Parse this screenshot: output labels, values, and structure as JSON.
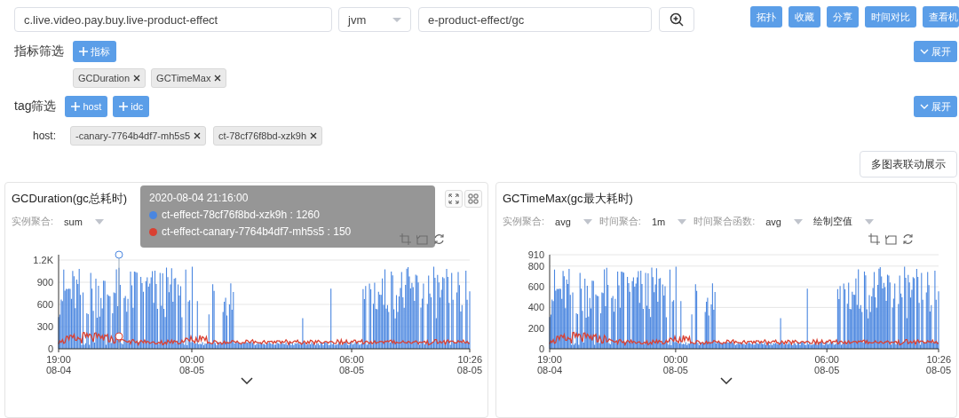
{
  "query": {
    "service": "c.live.video.pay.buy.live-product-effect",
    "type": "jvm",
    "path": "e-product-effect/gc"
  },
  "actions": [
    "拓扑",
    "收藏",
    "分享",
    "时间对比",
    "查看机"
  ],
  "metric_filter": {
    "label": "指标筛选",
    "add_button": "指标",
    "expand": "展开",
    "tags": [
      "GCDuration",
      "GCTimeMax"
    ]
  },
  "tag_filter": {
    "label": "tag筛选",
    "add_buttons": [
      "host",
      "idc"
    ],
    "expand": "展开",
    "host_label": "host:",
    "hosts": [
      "-canary-7764b4df7-mh5s5",
      "ct-78cf76f8bd-xzk9h"
    ]
  },
  "link_button": "多图表联动展示",
  "charts": [
    {
      "title": "GCDuration(gc总耗时)",
      "controls": [
        {
          "label": "实例聚合:",
          "value": "sum"
        }
      ],
      "y_ticks": [
        "1.2K",
        "900",
        "600",
        "300",
        "0"
      ],
      "x_ticks": [
        {
          "time": "19:00",
          "date": "08-04"
        },
        {
          "time": "00:00",
          "date": "08-05"
        },
        {
          "time": "06:00",
          "date": "08-05"
        },
        {
          "time": "10:26",
          "date": "08-05"
        }
      ],
      "tooltip": {
        "time": "2020-08-04 21:16:00",
        "rows": [
          {
            "text": "ct-effect-78cf76f8bd-xzk9h : 1260",
            "color": "#4a86e0"
          },
          {
            "text": "ct-effect-canary-7764b4df7-mh5s5 : 150",
            "color": "#d94032"
          }
        ]
      }
    },
    {
      "title": "GCTimeMax(gc最大耗时)",
      "controls": [
        {
          "label": "实例聚合:",
          "value": "avg"
        },
        {
          "label": "时间聚合:",
          "value": "1m"
        },
        {
          "label": "时间聚合函数:",
          "value": "avg"
        },
        {
          "value": "绘制空值"
        }
      ],
      "y_ticks": [
        "910",
        "800",
        "600",
        "400",
        "200",
        "0"
      ],
      "x_ticks": [
        {
          "time": "19:00",
          "date": "08-04"
        },
        {
          "time": "00:00",
          "date": "08-05"
        },
        {
          "time": "06:00",
          "date": "08-05"
        },
        {
          "time": "10:26",
          "date": "08-05"
        }
      ]
    }
  ]
}
